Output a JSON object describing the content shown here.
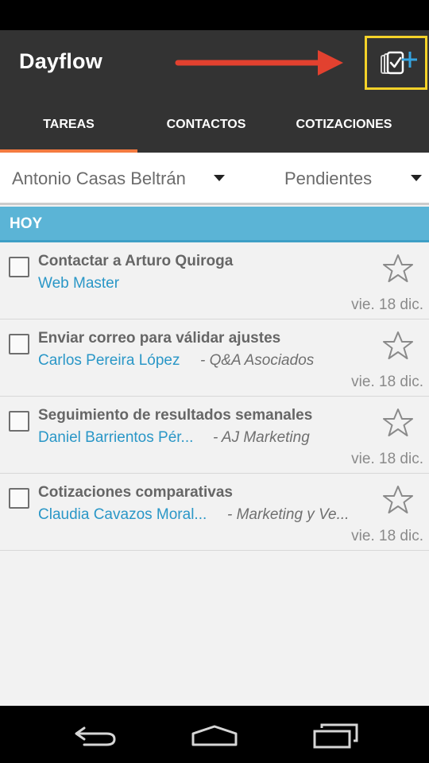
{
  "app": {
    "title": "Dayflow"
  },
  "tabs": [
    {
      "label": "TAREAS",
      "active": true
    },
    {
      "label": "CONTACTOS",
      "active": false
    },
    {
      "label": "COTIZACIONES",
      "active": false
    }
  ],
  "filters": {
    "user": "Antonio Casas Beltrán",
    "status": "Pendientes"
  },
  "section": {
    "label": "HOY"
  },
  "tasks": [
    {
      "title": "Contactar a Arturo Quiroga",
      "contact": "Web Master",
      "company": "",
      "date": "vie. 18 dic.",
      "starred": false,
      "done": false
    },
    {
      "title": "Enviar correo para válidar ajustes",
      "contact": "Carlos Pereira López",
      "company": "- Q&A Asociados",
      "date": "vie. 18 dic.",
      "starred": false,
      "done": false
    },
    {
      "title": "Seguimiento de resultados semanales",
      "contact": "Daniel Barrientos Pér...",
      "company": "- AJ Marketing",
      "date": "vie. 18 dic.",
      "starred": false,
      "done": false
    },
    {
      "title": "Cotizaciones comparativas",
      "contact": "Claudia Cavazos Moral...",
      "company": "- Marketing y Ve...",
      "date": "vie. 18 dic.",
      "starred": false,
      "done": false
    }
  ],
  "icons": {
    "new_task": "add-task-icon",
    "annotation": "red-arrow-icon",
    "star": "star-outline-icon",
    "nav_back": "back-icon",
    "nav_home": "home-icon",
    "nav_recents": "recents-icon"
  },
  "colors": {
    "app_bar": "#333333",
    "tab_indicator": "#f47b40",
    "section_header": "#5bb4d6",
    "contact_link": "#2a97c7",
    "highlight_box": "#f5d229",
    "annotation_arrow": "#e2412f"
  }
}
